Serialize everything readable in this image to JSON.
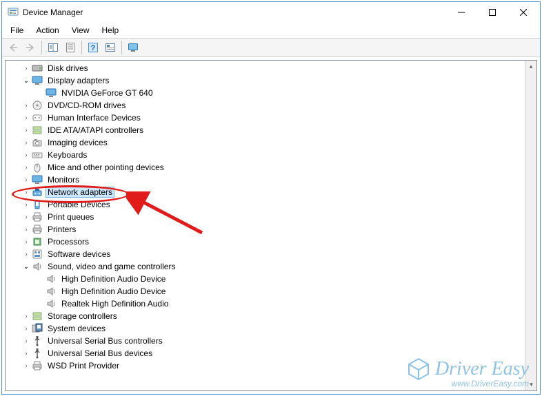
{
  "window": {
    "title": "Device Manager"
  },
  "menu": {
    "file": "File",
    "action": "Action",
    "view": "View",
    "help": "Help"
  },
  "tree": [
    {
      "id": "disk-drives",
      "label": "Disk drives",
      "level": 1,
      "expand": "closed",
      "icon": "hdd"
    },
    {
      "id": "display-adapters",
      "label": "Display adapters",
      "level": 1,
      "expand": "open",
      "icon": "monitor"
    },
    {
      "id": "nvidia-gt-640",
      "label": "NVIDIA GeForce GT 640",
      "level": 2,
      "expand": "none",
      "icon": "monitor"
    },
    {
      "id": "dvd-cd-rom-drives",
      "label": "DVD/CD-ROM drives",
      "level": 1,
      "expand": "closed",
      "icon": "optical"
    },
    {
      "id": "human-interface-devices",
      "label": "Human Interface Devices",
      "level": 1,
      "expand": "closed",
      "icon": "hid"
    },
    {
      "id": "ide-ata-atapi-controllers",
      "label": "IDE ATA/ATAPI controllers",
      "level": 1,
      "expand": "closed",
      "icon": "storage-ctrl"
    },
    {
      "id": "imaging-devices",
      "label": "Imaging devices",
      "level": 1,
      "expand": "closed",
      "icon": "camera"
    },
    {
      "id": "keyboards",
      "label": "Keyboards",
      "level": 1,
      "expand": "closed",
      "icon": "keyboard"
    },
    {
      "id": "mice-pointing",
      "label": "Mice and other pointing devices",
      "level": 1,
      "expand": "closed",
      "icon": "mouse"
    },
    {
      "id": "monitors",
      "label": "Monitors",
      "level": 1,
      "expand": "closed",
      "icon": "monitor"
    },
    {
      "id": "network-adapters",
      "label": "Network adapters",
      "level": 1,
      "expand": "closed",
      "icon": "network",
      "selected": true
    },
    {
      "id": "portable-devices",
      "label": "Portable Devices",
      "level": 1,
      "expand": "closed",
      "icon": "portable"
    },
    {
      "id": "print-queues",
      "label": "Print queues",
      "level": 1,
      "expand": "closed",
      "icon": "printer"
    },
    {
      "id": "printers",
      "label": "Printers",
      "level": 1,
      "expand": "closed",
      "icon": "printer"
    },
    {
      "id": "processors",
      "label": "Processors",
      "level": 1,
      "expand": "closed",
      "icon": "cpu"
    },
    {
      "id": "software-devices",
      "label": "Software devices",
      "level": 1,
      "expand": "closed",
      "icon": "software"
    },
    {
      "id": "sound-video-game",
      "label": "Sound, video and game controllers",
      "level": 1,
      "expand": "open",
      "icon": "speaker"
    },
    {
      "id": "hd-audio-1",
      "label": "High Definition Audio Device",
      "level": 2,
      "expand": "none",
      "icon": "speaker"
    },
    {
      "id": "hd-audio-2",
      "label": "High Definition Audio Device",
      "level": 2,
      "expand": "none",
      "icon": "speaker"
    },
    {
      "id": "realtek-audio",
      "label": "Realtek High Definition Audio",
      "level": 2,
      "expand": "none",
      "icon": "speaker"
    },
    {
      "id": "storage-controllers",
      "label": "Storage controllers",
      "level": 1,
      "expand": "closed",
      "icon": "storage-ctrl"
    },
    {
      "id": "system-devices",
      "label": "System devices",
      "level": 1,
      "expand": "closed",
      "icon": "system"
    },
    {
      "id": "usb-controllers",
      "label": "Universal Serial Bus controllers",
      "level": 1,
      "expand": "closed",
      "icon": "usb"
    },
    {
      "id": "usb-devices",
      "label": "Universal Serial Bus devices",
      "level": 1,
      "expand": "closed",
      "icon": "usb"
    },
    {
      "id": "wsd-print-provider",
      "label": "WSD Print Provider",
      "level": 1,
      "expand": "closed",
      "icon": "printer"
    }
  ],
  "watermark": {
    "brand": "Driver Easy",
    "url": "www.DriverEasy.com"
  }
}
